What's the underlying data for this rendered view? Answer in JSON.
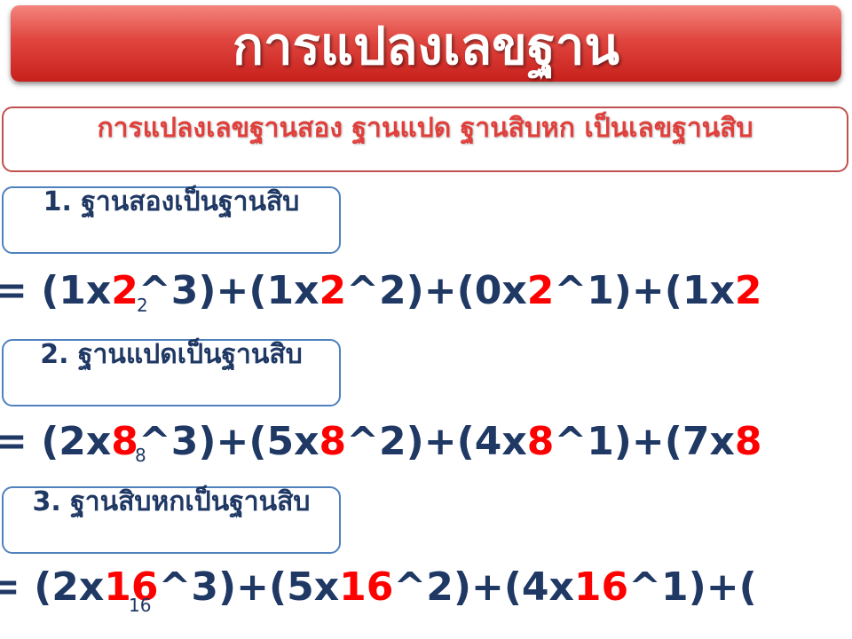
{
  "title": "การแปลงเลขฐาน",
  "subtitle": "การแปลงเลขฐานสอง ฐานแปด ฐานสิบหก เป็นเลขฐานสิบ",
  "sections": [
    {
      "label": "1. ฐานสองเป็นฐานสิบ",
      "formula": {
        "lead": "= ",
        "terms": [
          {
            "open": "(1x",
            "base": "2",
            "exp": "^3)",
            "sep": "+"
          },
          {
            "open": "(1x",
            "base": "2",
            "exp": "^2)",
            "sep": "+"
          },
          {
            "open": "(0x",
            "base": "2",
            "exp": "^1)",
            "sep": "+"
          },
          {
            "open": "(1x",
            "base": "2",
            "exp": "",
            "sep": ""
          }
        ]
      },
      "base_subscript": "2"
    },
    {
      "label": "2. ฐานแปดเป็นฐานสิบ",
      "formula": {
        "lead": "= ",
        "terms": [
          {
            "open": "(2x",
            "base": "8",
            "exp": "^3)",
            "sep": "+"
          },
          {
            "open": "(5x",
            "base": "8",
            "exp": "^2)",
            "sep": "+"
          },
          {
            "open": "(4x",
            "base": "8",
            "exp": "^1)",
            "sep": "+"
          },
          {
            "open": "(7x",
            "base": "8",
            "exp": "",
            "sep": ""
          }
        ]
      },
      "base_subscript": "8"
    },
    {
      "label": "3. ฐานสิบหกเป็นฐานสิบ",
      "formula": {
        "lead": "= ",
        "terms": [
          {
            "open": "(2x",
            "base": "16",
            "exp": "^3)",
            "sep": "+"
          },
          {
            "open": "(5x",
            "base": "16",
            "exp": "^2)",
            "sep": "+"
          },
          {
            "open": "(4x",
            "base": "16",
            "exp": "^1)",
            "sep": "+"
          },
          {
            "open": "(",
            "base": "",
            "exp": "",
            "sep": ""
          }
        ]
      },
      "base_subscript": "16"
    }
  ],
  "colors": {
    "title_bg": "#e0463f",
    "subtitle_text": "#e0403c",
    "label_border": "#4f81bd",
    "label_text": "#1f3864",
    "formula_text": "#1f3864",
    "base_highlight": "#ff0000"
  }
}
